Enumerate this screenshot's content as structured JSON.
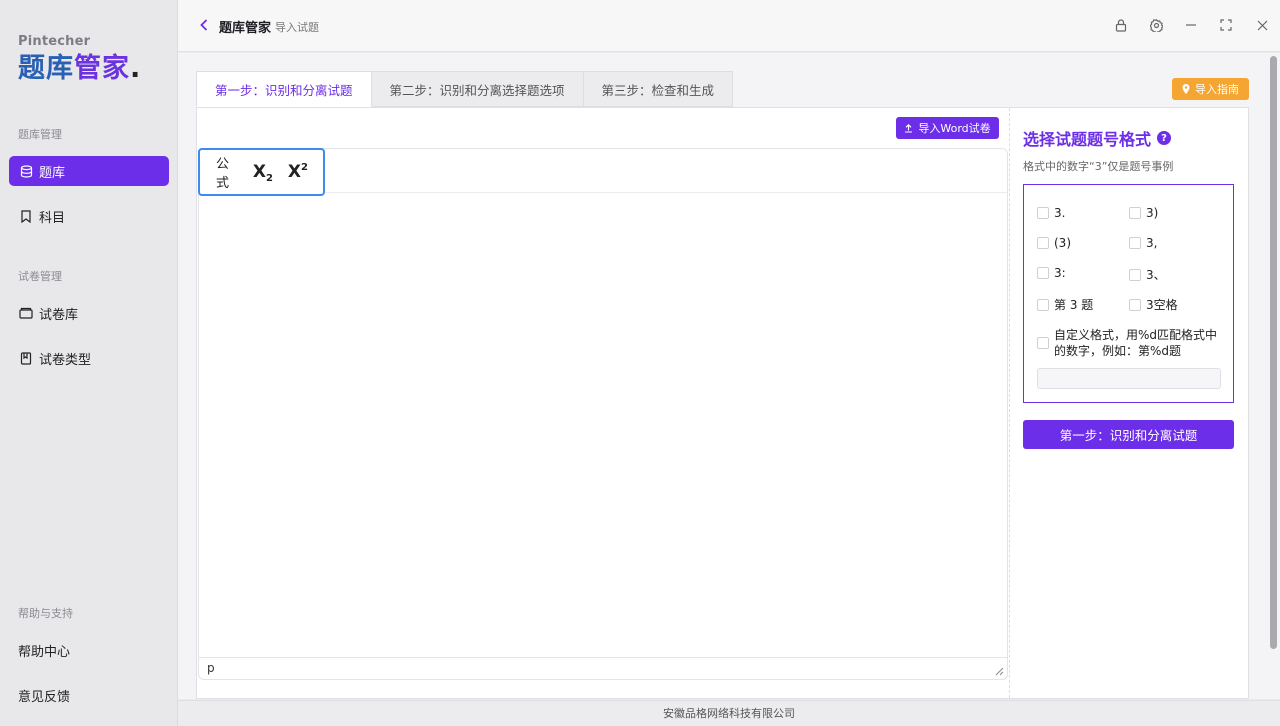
{
  "brand": {
    "en": "Pintecher",
    "cn_part1": "题库",
    "cn_part2": "管家",
    "cn_dot": "."
  },
  "sidebar": {
    "sections": [
      {
        "label": "题库管理"
      },
      {
        "label": "试卷管理"
      },
      {
        "label": "帮助与支持"
      }
    ],
    "items": [
      {
        "label": "题库",
        "icon": "database-icon",
        "active": true
      },
      {
        "label": "科目",
        "icon": "bookmark-icon"
      },
      {
        "label": "试卷库",
        "icon": "folder-icon"
      },
      {
        "label": "试卷类型",
        "icon": "notebook-icon"
      },
      {
        "label": "帮助中心"
      },
      {
        "label": "意见反馈"
      }
    ]
  },
  "header": {
    "title": "题库管家",
    "subtitle": "导入试题"
  },
  "tabs": [
    {
      "label": "第一步：识别和分离试题",
      "active": true
    },
    {
      "label": "第二步：识别和分离选择题选项"
    },
    {
      "label": "第三步：检查和生成"
    }
  ],
  "guide_button": "导入指南",
  "upload_button": "导入Word试卷",
  "editor": {
    "toolbar": {
      "formula": "公式",
      "subscript": "X",
      "subscript_mark": "2",
      "superscript": "X",
      "superscript_mark": "2"
    },
    "status_path": "p"
  },
  "format_panel": {
    "title": "选择试题题号格式",
    "help": "?",
    "hint": "格式中的数字“3”仅是题号事例",
    "options": [
      "3.",
      "3)",
      "(3)",
      "3,",
      "3:",
      "3、",
      "第 3 题",
      "3空格"
    ],
    "custom_option": "自定义格式，用%d匹配格式中的数字，例如：第%d题",
    "custom_value": "",
    "submit": "第一步：识别和分离试题"
  },
  "footer": "安徽品格网络科技有限公司",
  "colors": {
    "accent": "#6c2ee8",
    "guide": "#f5a531",
    "focus": "#3e8bf0"
  }
}
